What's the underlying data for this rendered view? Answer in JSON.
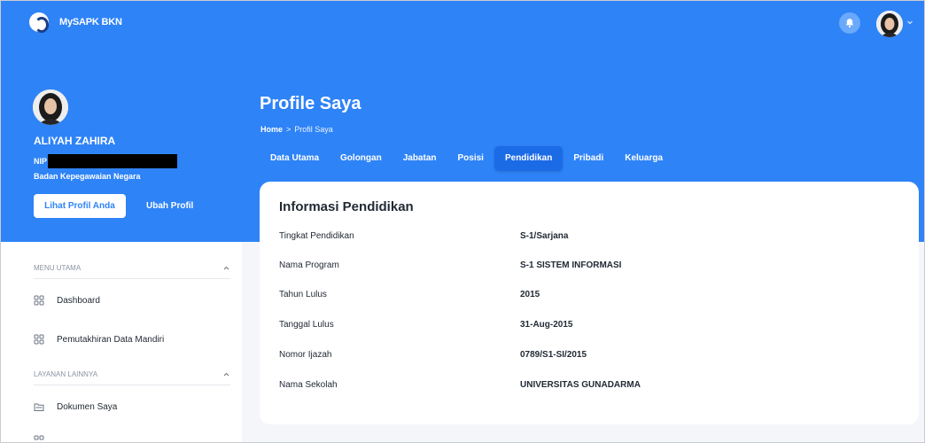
{
  "header": {
    "brand_name": "MySAPK BKN"
  },
  "profile": {
    "name": "ALIYAH ZAHIRA",
    "nip_label": "NIP",
    "org": "Badan Kepegawaian Negara",
    "view_button": "Lihat Profil Anda",
    "edit_button": "Ubah Profil"
  },
  "page": {
    "title": "Profile Saya",
    "breadcrumb_home": "Home",
    "breadcrumb_sep": ">",
    "breadcrumb_current": "Profil Saya"
  },
  "tabs": [
    {
      "label": "Data Utama",
      "active": false
    },
    {
      "label": "Golongan",
      "active": false
    },
    {
      "label": "Jabatan",
      "active": false
    },
    {
      "label": "Posisi",
      "active": false
    },
    {
      "label": "Pendidikan",
      "active": true
    },
    {
      "label": "Pribadi",
      "active": false
    },
    {
      "label": "Keluarga",
      "active": false
    }
  ],
  "card": {
    "title": "Informasi Pendidikan",
    "rows": [
      {
        "label": "Tingkat Pendidikan",
        "value": "S-1/Sarjana"
      },
      {
        "label": "Nama Program",
        "value": "S-1 SISTEM INFORMASI"
      },
      {
        "label": "Tahun Lulus",
        "value": "2015"
      },
      {
        "label": "Tanggal Lulus",
        "value": "31-Aug-2015"
      },
      {
        "label": "Nomor Ijazah",
        "value": "0789/S1-SI/2015"
      },
      {
        "label": "Nama Sekolah",
        "value": "UNIVERSITAS GUNADARMA"
      }
    ]
  },
  "sidebar": {
    "sections": [
      {
        "title": "MENU UTAMA",
        "items": [
          {
            "label": "Dashboard",
            "icon": "grid-icon"
          },
          {
            "label": "Pemutakhiran Data Mandiri",
            "icon": "grid-icon"
          }
        ]
      },
      {
        "title": "LAYANAN LAINNYA",
        "items": [
          {
            "label": "Dokumen Saya",
            "icon": "folder-icon"
          }
        ]
      }
    ]
  },
  "colors": {
    "primary": "#2e83f7",
    "active_tab": "#1b6ae6",
    "background": "#f4f6fa"
  }
}
